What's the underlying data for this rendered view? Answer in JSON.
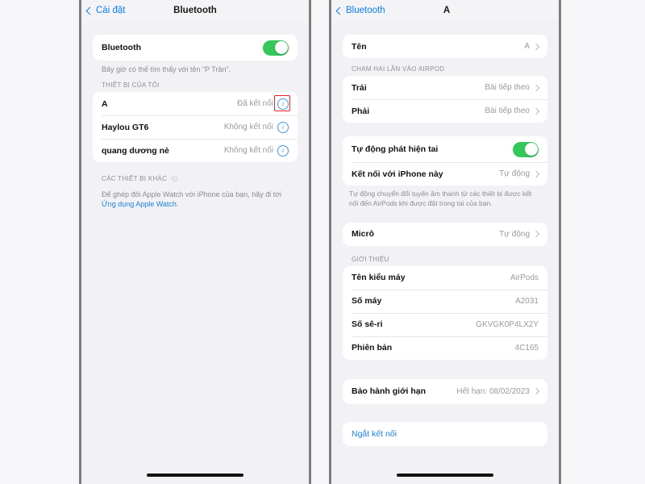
{
  "left_phone": {
    "nav": {
      "back_label": "Cài đặt",
      "title": "Bluetooth"
    },
    "bluetooth_toggle": {
      "label": "Bluetooth",
      "state": "on",
      "accent": "#34c759"
    },
    "discoverable_note": "Bây giờ có thể tìm thấy với tên \"P Trần\".",
    "my_devices_header": "THIẾT BỊ CỦA TÔI",
    "devices": [
      {
        "name": "A",
        "status": "Đã kết nối",
        "highlighted": true
      },
      {
        "name": "Haylou GT6",
        "status": "Không kết nối",
        "highlighted": false
      },
      {
        "name": "quang dương nè",
        "status": "Không kết nối",
        "highlighted": false
      }
    ],
    "other_devices_header": "CÁC THIẾT BỊ KHÁC",
    "pair_note_prefix": "Để ghép đôi Apple Watch với iPhone của bạn, hãy đi tới ",
    "pair_note_link": "Ứng dụng Apple Watch",
    "pair_note_suffix": ".",
    "annotation": {
      "highlight_color": "#e32020",
      "arrow_color": "#cc2222"
    }
  },
  "right_phone": {
    "nav": {
      "back_label": "Bluetooth",
      "title": "A"
    },
    "name_row": {
      "label": "Tên",
      "value": "A"
    },
    "double_tap_header": "CHẠM HAI LẦN VÀO AIRPOD",
    "double_tap_rows": [
      {
        "label": "Trái",
        "value": "Bài tiếp theo"
      },
      {
        "label": "Phải",
        "value": "Bài tiếp theo"
      }
    ],
    "ear_detect": {
      "label": "Tự động phát hiện tai",
      "state": "on"
    },
    "connect_row": {
      "label": "Kết nối với iPhone này",
      "value": "Tự động"
    },
    "connect_note": "Tự động chuyển đổi tuyến âm thanh từ các thiết bị được kết nối đến AirPods khi được đặt trong tai của bạn.",
    "mic_row": {
      "label": "Micrô",
      "value": "Tự động"
    },
    "about_header": "GIỚI THIỆU",
    "about_rows": [
      {
        "label": "Tên kiểu máy",
        "value": "AirPods"
      },
      {
        "label": "Số máy",
        "value": "A2031"
      },
      {
        "label": "Số sê-ri",
        "value": "GKVGK0P4LX2Y"
      },
      {
        "label": "Phiên bản",
        "value": "4C165"
      }
    ],
    "warranty_row": {
      "label": "Bảo hành giới hạn",
      "value": "Hết hạn: 08/02/2023"
    },
    "disconnect_label": "Ngắt kết nối"
  }
}
